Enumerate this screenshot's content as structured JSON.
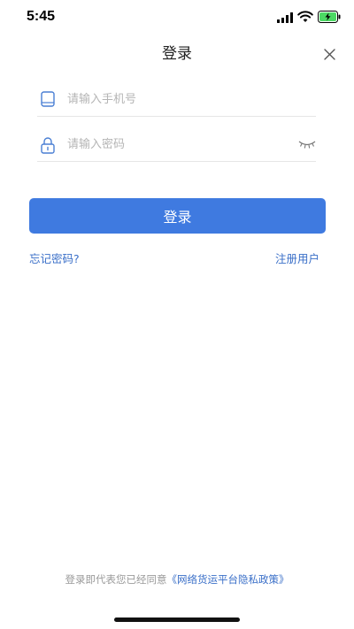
{
  "status_bar": {
    "time": "5:45"
  },
  "nav": {
    "title": "登录"
  },
  "form": {
    "phone_placeholder": "请输入手机号",
    "password_placeholder": "请输入密码"
  },
  "actions": {
    "login_label": "登录",
    "forgot_label": "忘记密码?",
    "register_label": "注册用户"
  },
  "footer": {
    "agreement_prefix": "登录即代表您已经同意",
    "policy_link": "《网络货运平台隐私政策》"
  },
  "colors": {
    "primary": "#3f7ae0",
    "link": "#3a6fc8",
    "battery_charging": "#4cd964"
  }
}
